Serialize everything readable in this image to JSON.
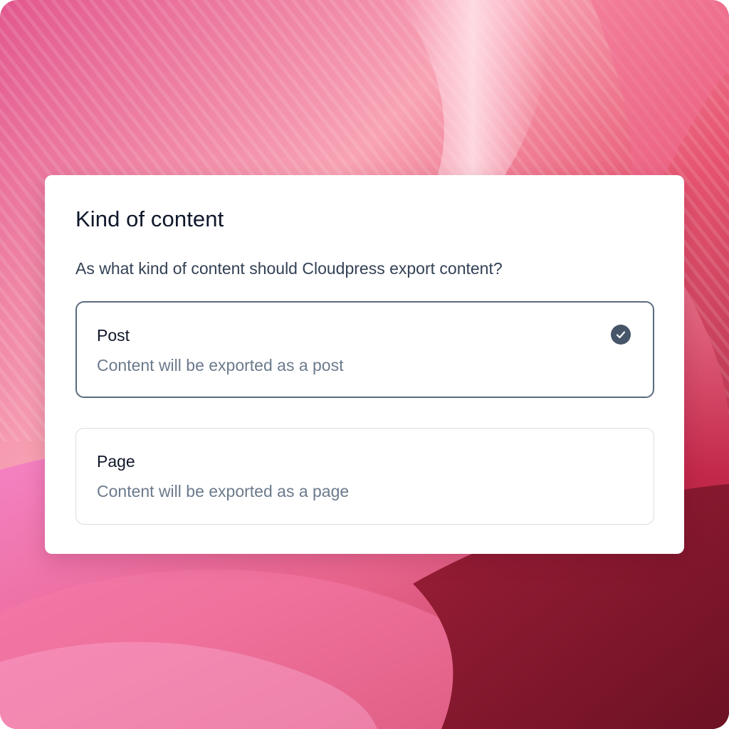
{
  "dialog": {
    "title": "Kind of content",
    "question": "As what kind of content should Cloudpress export content?"
  },
  "options": [
    {
      "label": "Post",
      "description": "Content will be exported as a post",
      "selected": true,
      "icon": "check-circle-icon"
    },
    {
      "label": "Page",
      "description": "Content will be exported as a page",
      "selected": false
    }
  ],
  "colors": {
    "selected_border": "#5b6b7d",
    "check_fill": "#475569",
    "title_text": "#0f172a",
    "muted_text": "#6b7a8c"
  }
}
